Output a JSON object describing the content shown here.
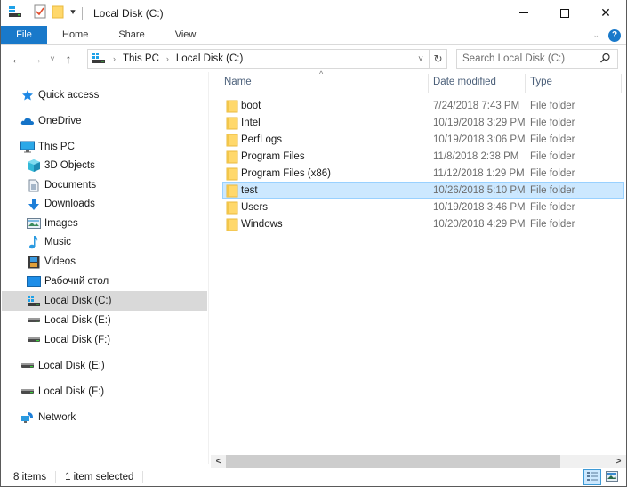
{
  "window": {
    "title": "Local Disk (C:)",
    "controls": {
      "minimize": "—",
      "maximize": "☐",
      "close": "✕"
    }
  },
  "ribbon": {
    "tabs": [
      {
        "label": "File",
        "active": true
      },
      {
        "label": "Home"
      },
      {
        "label": "Share"
      },
      {
        "label": "View"
      }
    ],
    "expand_icon": "chevron-down-icon",
    "help_label": "?"
  },
  "navigation": {
    "back_icon": "←",
    "forward_icon": "→",
    "recent_icon": "˅",
    "up_icon": "↑",
    "breadcrumb": [
      "This PC",
      "Local Disk (C:)"
    ],
    "breadcrumb_separator": "›",
    "dropdown_icon": "˅",
    "refresh_icon": "↻",
    "search_placeholder": "Search Local Disk (C:)",
    "search_value": ""
  },
  "sidebar": {
    "items": [
      {
        "label": "Quick access",
        "icon": "star-icon",
        "level": 0
      },
      {
        "label": "OneDrive",
        "icon": "cloud-icon",
        "level": 0
      },
      {
        "label": "This PC",
        "icon": "monitor-icon",
        "level": 0
      },
      {
        "label": "3D Objects",
        "icon": "cube-icon",
        "level": 1
      },
      {
        "label": "Documents",
        "icon": "document-icon",
        "level": 1
      },
      {
        "label": "Downloads",
        "icon": "download-arrow-icon",
        "level": 1
      },
      {
        "label": "Images",
        "icon": "picture-icon",
        "level": 1
      },
      {
        "label": "Music",
        "icon": "music-note-icon",
        "level": 1
      },
      {
        "label": "Videos",
        "icon": "film-icon",
        "level": 1
      },
      {
        "label": "Рабочий стол",
        "icon": "desktop-icon",
        "level": 1
      },
      {
        "label": "Local Disk (C:)",
        "icon": "windows-drive-icon",
        "level": 1,
        "selected": true
      },
      {
        "label": "Local Disk (E:)",
        "icon": "drive-icon",
        "level": 1
      },
      {
        "label": "Local Disk (F:)",
        "icon": "drive-icon",
        "level": 1
      },
      {
        "label": "Local Disk (E:)",
        "icon": "drive-icon",
        "level": 0
      },
      {
        "label": "Local Disk (F:)",
        "icon": "drive-icon",
        "level": 0
      },
      {
        "label": "Network",
        "icon": "network-icon",
        "level": 0
      }
    ]
  },
  "filelist": {
    "columns": {
      "name": "Name",
      "date": "Date modified",
      "type": "Type"
    },
    "sort_indicator": "^",
    "rows": [
      {
        "name": "boot",
        "date": "7/24/2018 7:43 PM",
        "type": "File folder"
      },
      {
        "name": "Intel",
        "date": "10/19/2018 3:29 PM",
        "type": "File folder"
      },
      {
        "name": "PerfLogs",
        "date": "10/19/2018 3:06 PM",
        "type": "File folder"
      },
      {
        "name": "Program Files",
        "date": "11/8/2018 2:38 PM",
        "type": "File folder"
      },
      {
        "name": "Program Files (x86)",
        "date": "11/12/2018 1:29 PM",
        "type": "File folder"
      },
      {
        "name": "test",
        "date": "10/26/2018 5:10 PM",
        "type": "File folder",
        "selected": true
      },
      {
        "name": "Users",
        "date": "10/19/2018 3:46 PM",
        "type": "File folder"
      },
      {
        "name": "Windows",
        "date": "10/20/2018 4:29 PM",
        "type": "File folder"
      }
    ]
  },
  "scrollbar": {
    "left_arrow": "<",
    "right_arrow": ">"
  },
  "status": {
    "item_count": "8 items",
    "selection": "1 item selected"
  },
  "colors": {
    "accent": "#1979ca",
    "selection_bg": "#cce8ff",
    "selection_border": "#99d1ff",
    "nav_selected": "#d9d9d9",
    "folder": "#ffd86b"
  }
}
